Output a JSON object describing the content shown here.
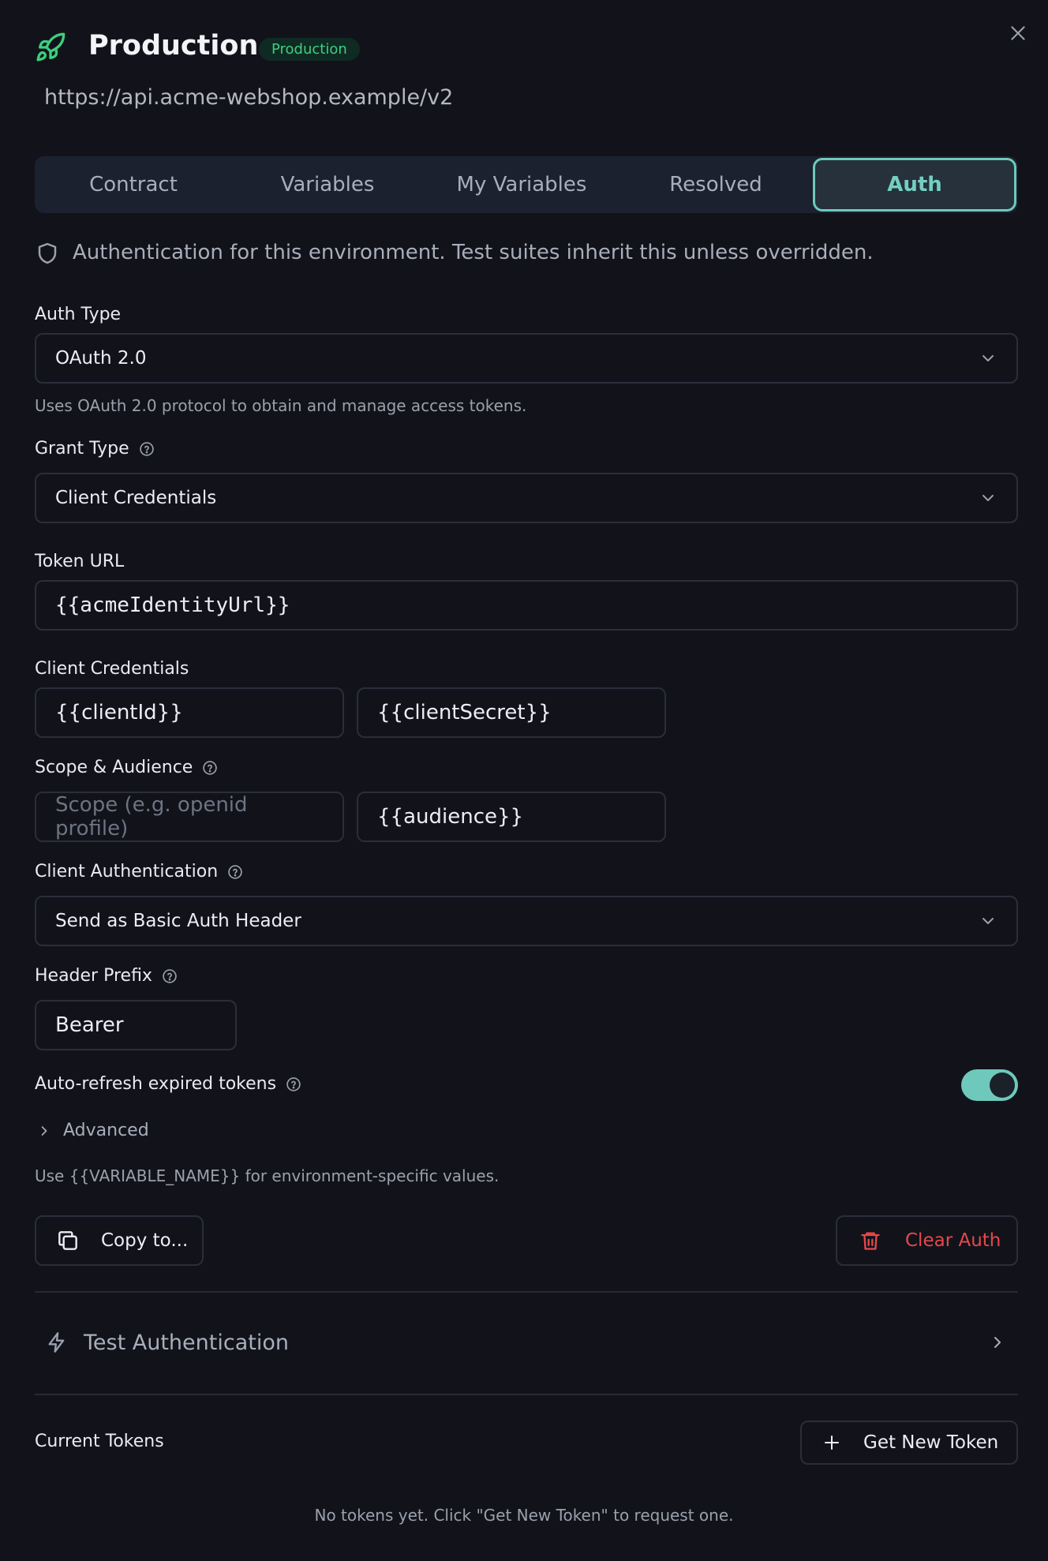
{
  "header": {
    "title": "Production",
    "badge": "Production",
    "url": "https://api.acme-webshop.example/v2"
  },
  "tabs": [
    {
      "label": "Contract"
    },
    {
      "label": "Variables"
    },
    {
      "label": "My Variables"
    },
    {
      "label": "Resolved"
    },
    {
      "label": "Auth",
      "active": true
    }
  ],
  "info": "Authentication for this environment. Test suites inherit this unless overridden.",
  "auth_type": {
    "label": "Auth Type",
    "value": "OAuth 2.0",
    "hint": "Uses OAuth 2.0 protocol to obtain and manage access tokens."
  },
  "grant_type": {
    "label": "Grant Type",
    "value": "Client Credentials"
  },
  "token_url": {
    "label": "Token URL",
    "value": "{{acmeIdentityUrl}}"
  },
  "client_credentials": {
    "label": "Client Credentials",
    "client_id": "{{clientId}}",
    "client_secret": "{{clientSecret}}"
  },
  "scope_audience": {
    "label": "Scope & Audience",
    "scope_placeholder": "Scope (e.g. openid profile)",
    "audience": "{{audience}}"
  },
  "client_auth": {
    "label": "Client Authentication",
    "value": "Send as Basic Auth Header"
  },
  "header_prefix": {
    "label": "Header Prefix",
    "value": "Bearer"
  },
  "auto_refresh": {
    "label": "Auto-refresh expired tokens",
    "enabled": true
  },
  "advanced": {
    "label": "Advanced"
  },
  "variable_hint": "Use {{VARIABLE_NAME}} for environment-specific values.",
  "actions": {
    "copy_label": "Copy to...",
    "clear_label": "Clear Auth"
  },
  "test_auth": {
    "label": "Test Authentication"
  },
  "tokens": {
    "label": "Current Tokens",
    "get_new_label": "Get New Token",
    "empty": "No tokens yet. Click \"Get New Token\" to request one."
  },
  "colors": {
    "background": "#12131a",
    "accent": "#6ec9bc",
    "danger": "#e5484d",
    "success": "#3ccf7e"
  }
}
